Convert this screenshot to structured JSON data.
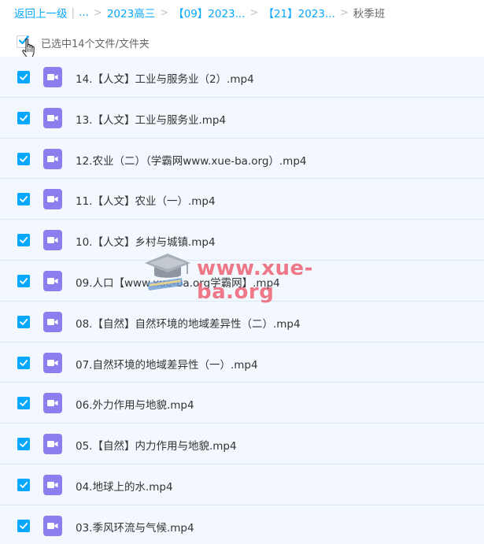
{
  "breadcrumb": {
    "back": "返回上一级",
    "ellipsis": "...",
    "items": [
      "2023高三",
      "【09】2023...",
      "【21】2023..."
    ],
    "current": "秋季班"
  },
  "selection": {
    "label": "已选中14个文件/文件夹",
    "checked": true
  },
  "files": [
    {
      "name": "14.【人文】工业与服务业（2）.mp4",
      "checked": true
    },
    {
      "name": "13.【人文】工业与服务业.mp4",
      "checked": true
    },
    {
      "name": "12.农业（二）（学霸网www.xue-ba.org）.mp4",
      "checked": true
    },
    {
      "name": "11.【人文】农业（一）.mp4",
      "checked": true
    },
    {
      "name": "10.【人文】乡村与城镇.mp4",
      "checked": true
    },
    {
      "name": "09.人口【www.xue-ba.org学霸网】.mp4",
      "checked": true
    },
    {
      "name": "08.【自然】自然环境的地域差异性（二）.mp4",
      "checked": true
    },
    {
      "name": "07.自然环境的地域差异性（一）.mp4",
      "checked": true
    },
    {
      "name": "06.外力作用与地貌.mp4",
      "checked": true
    },
    {
      "name": "05.【自然】内力作用与地貌.mp4",
      "checked": true
    },
    {
      "name": "04.地球上的水.mp4",
      "checked": true
    },
    {
      "name": "03.季风环流与气候.mp4",
      "checked": true
    }
  ],
  "watermark": {
    "text": "www.xue-ba.org"
  },
  "colors": {
    "accent": "#06a7ff",
    "row_selected_bg": "#f2f8fe",
    "video_icon": "#8b7ff0",
    "watermark": "#ee5c6e"
  },
  "icons": {
    "checkbox": "check-icon",
    "file": "video-file-icon",
    "cursor": "hand-pointer-icon",
    "watermark_logo": "graduation-cap-icon"
  }
}
